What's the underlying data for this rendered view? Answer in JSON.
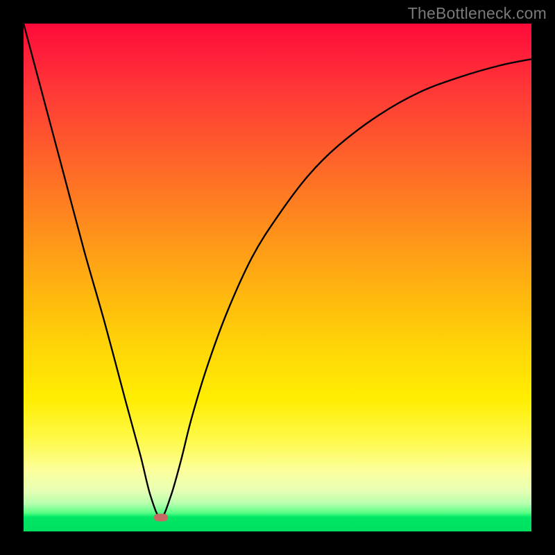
{
  "watermark": "TheBottleneck.com",
  "marker": {
    "x_pct": 27.0,
    "y_pct": 97.3
  },
  "chart_data": {
    "type": "line",
    "title": "",
    "xlabel": "",
    "ylabel": "",
    "xlim": [
      0,
      100
    ],
    "ylim": [
      0,
      100
    ],
    "grid": false,
    "legend": false,
    "series": [
      {
        "name": "bottleneck-curve",
        "x": [
          0,
          4,
          8,
          12,
          16,
          20,
          23,
          25,
          27,
          29,
          31,
          33,
          36,
          40,
          45,
          50,
          56,
          62,
          70,
          78,
          86,
          94,
          100
        ],
        "y": [
          100,
          85,
          70,
          55,
          41,
          26,
          15,
          7,
          2.7,
          7,
          14,
          22,
          32,
          43,
          54,
          62,
          70,
          76,
          82,
          86.5,
          89.5,
          91.8,
          93
        ]
      }
    ],
    "annotations": [
      {
        "type": "marker",
        "x": 27,
        "y": 2.7,
        "label": "optimal-point"
      }
    ],
    "background": {
      "type": "gradient",
      "stops": [
        {
          "pct": 0,
          "color": "#ff0a3a"
        },
        {
          "pct": 50,
          "color": "#ffaa10"
        },
        {
          "pct": 80,
          "color": "#fff64a"
        },
        {
          "pct": 97,
          "color": "#00e765"
        },
        {
          "pct": 100,
          "color": "#00df5f"
        }
      ]
    }
  }
}
